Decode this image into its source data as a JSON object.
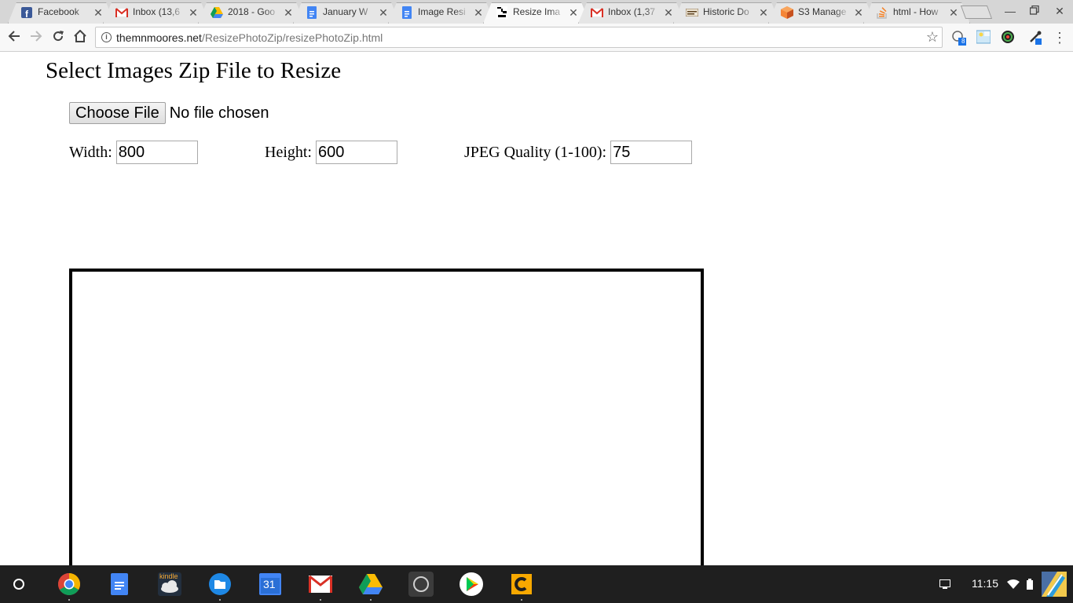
{
  "tabs": [
    {
      "title": "Facebook",
      "icon": "facebook-icon",
      "active": false
    },
    {
      "title": "Inbox (13,6",
      "icon": "gmail-icon",
      "active": false
    },
    {
      "title": "2018 - Goo",
      "icon": "google-drive-icon",
      "active": false
    },
    {
      "title": "January W",
      "icon": "google-docs-icon",
      "active": false
    },
    {
      "title": "Image Resi",
      "icon": "google-docs-icon",
      "active": false
    },
    {
      "title": "Resize Ima",
      "icon": "the-hour-icon",
      "active": true
    },
    {
      "title": "Inbox (1,37",
      "icon": "gmail-icon",
      "active": false
    },
    {
      "title": "Historic Do",
      "icon": "document-icon",
      "active": false
    },
    {
      "title": "S3 Manage",
      "icon": "aws-s3-icon",
      "active": false
    },
    {
      "title": "html - How",
      "icon": "stackoverflow-icon",
      "active": false
    }
  ],
  "toolbar": {
    "url_host": "themnmoores.net",
    "url_path": "/ResizePhotoZip/resizePhotoZip.html",
    "extension_badge": "8"
  },
  "page": {
    "heading": "Select Images Zip File to Resize",
    "choose_file_label": "Choose File",
    "no_file_text": "No file chosen",
    "width_label": "Width:",
    "width_value": "800",
    "height_label": "Height:",
    "height_value": "600",
    "quality_label": "JPEG Quality (1-100):",
    "quality_value": "75"
  },
  "shelf": {
    "apps": [
      "chrome-icon",
      "google-docs-icon",
      "kindle-icon",
      "files-icon",
      "calendar-icon",
      "gmail-icon",
      "google-drive-icon",
      "camera-icon",
      "play-store-icon",
      "c-app-icon"
    ],
    "calendar_day": "31",
    "kindle_text": "kindle",
    "time": "11:15"
  }
}
